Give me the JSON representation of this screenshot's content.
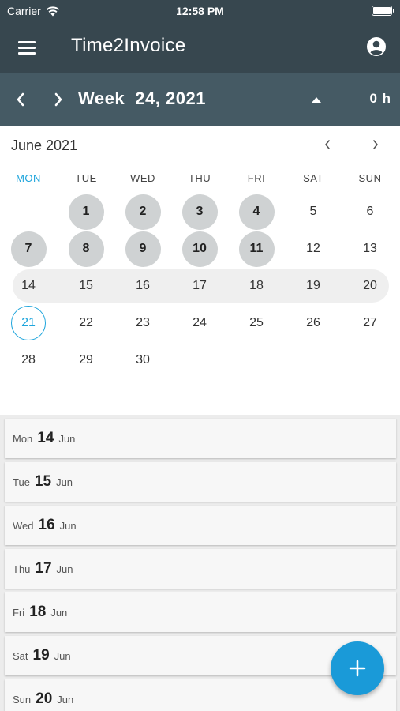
{
  "status_bar": {
    "carrier": "Carrier",
    "time": "12:58 PM"
  },
  "app_bar": {
    "title": "Time2Invoice"
  },
  "week_bar": {
    "label": "Week  24, 2021",
    "hours": "0 h"
  },
  "calendar": {
    "month_title": "June 2021",
    "weekdays": [
      "MON",
      "TUE",
      "WED",
      "THU",
      "FRI",
      "SAT",
      "SUN"
    ],
    "active_weekday": "MON",
    "weeks": [
      [
        "",
        "1",
        "2",
        "3",
        "4",
        "5",
        "6"
      ],
      [
        "7",
        "8",
        "9",
        "10",
        "11",
        "12",
        "13"
      ],
      [
        "14",
        "15",
        "16",
        "17",
        "18",
        "19",
        "20"
      ],
      [
        "21",
        "22",
        "23",
        "24",
        "25",
        "26",
        "27"
      ],
      [
        "28",
        "29",
        "30",
        "",
        "",
        "",
        ""
      ]
    ],
    "logged_days": [
      "1",
      "2",
      "3",
      "4",
      "7",
      "8",
      "9",
      "10",
      "11"
    ],
    "today": "21",
    "selected_week": [
      "14",
      "15",
      "16",
      "17",
      "18",
      "19",
      "20"
    ]
  },
  "day_list": [
    {
      "weekday": "Mon",
      "day": "14",
      "month": "Jun"
    },
    {
      "weekday": "Tue",
      "day": "15",
      "month": "Jun"
    },
    {
      "weekday": "Wed",
      "day": "16",
      "month": "Jun"
    },
    {
      "weekday": "Thu",
      "day": "17",
      "month": "Jun"
    },
    {
      "weekday": "Fri",
      "day": "18",
      "month": "Jun"
    },
    {
      "weekday": "Sat",
      "day": "19",
      "month": "Jun"
    },
    {
      "weekday": "Sun",
      "day": "20",
      "month": "Jun"
    }
  ],
  "colors": {
    "app_bar": "#37474f",
    "week_bar": "#455a64",
    "accent": "#1ea5dc",
    "fab": "#1a9ad8",
    "logged_day": "#cfd2d3"
  },
  "icons": {
    "menu": "hamburger-icon",
    "account": "account-circle-icon",
    "prev_week": "chevron-left-icon",
    "next_week": "chevron-right-icon",
    "collapse": "caret-up-icon",
    "prev_month": "chevron-left-icon",
    "next_month": "chevron-right-icon",
    "fab": "plus-icon"
  }
}
